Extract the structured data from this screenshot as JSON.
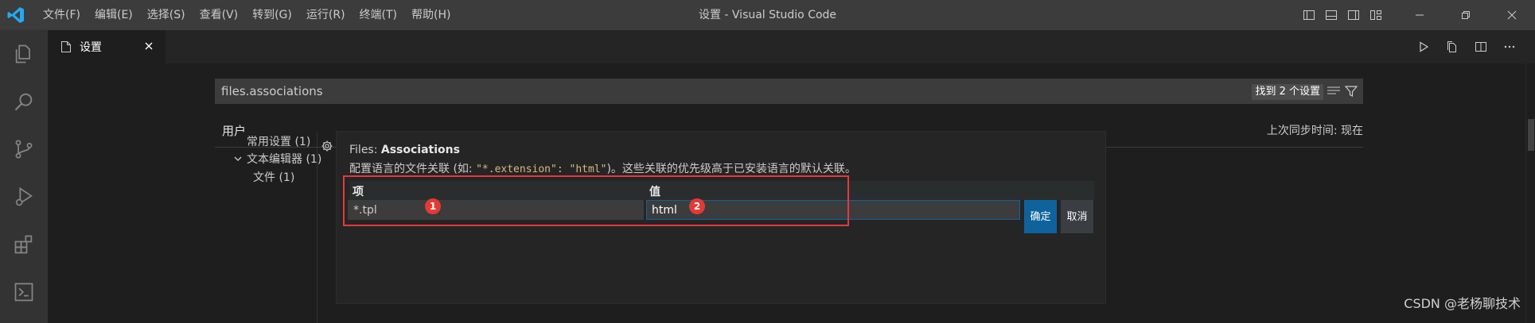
{
  "window": {
    "title": "设置 - Visual Studio Code",
    "menu": [
      "文件(F)",
      "编辑(E)",
      "选择(S)",
      "查看(V)",
      "转到(G)",
      "运行(R)",
      "终端(T)",
      "帮助(H)"
    ]
  },
  "activity_bar": {
    "items": [
      "explorer-icon",
      "search-icon",
      "source-control-icon",
      "run-debug-icon",
      "extensions-icon",
      "remote-explorer-icon"
    ]
  },
  "tab": {
    "label": "设置"
  },
  "settings": {
    "search_value": "files.associations",
    "search_count": "找到 2 个设置",
    "scope_tab": "用户",
    "sync_time": "上次同步时间: 现在",
    "toc": [
      {
        "label": "常用设置 (1)"
      },
      {
        "label": "文本编辑器 (1)"
      },
      {
        "label": "文件 (1)"
      }
    ],
    "setting": {
      "category": "Files: ",
      "name": "Associations",
      "desc_prefix": "配置语言的文件关联 (如: ",
      "desc_code": "\"*.extension\": \"html\"",
      "desc_suffix": ")。这些关联的优先级高于已安装语言的默认关联。",
      "col_item": "项",
      "col_value": "值",
      "item_value": "*.tpl",
      "value_value": "html",
      "ok_label": "确定",
      "cancel_label": "取消"
    }
  },
  "annotations": {
    "badge1": "1",
    "badge2": "2"
  },
  "watermark": "CSDN @老杨聊技术",
  "colors": {
    "accent": "#0e639c",
    "highlight": "#e5393a",
    "code": "#d7ba7d"
  }
}
